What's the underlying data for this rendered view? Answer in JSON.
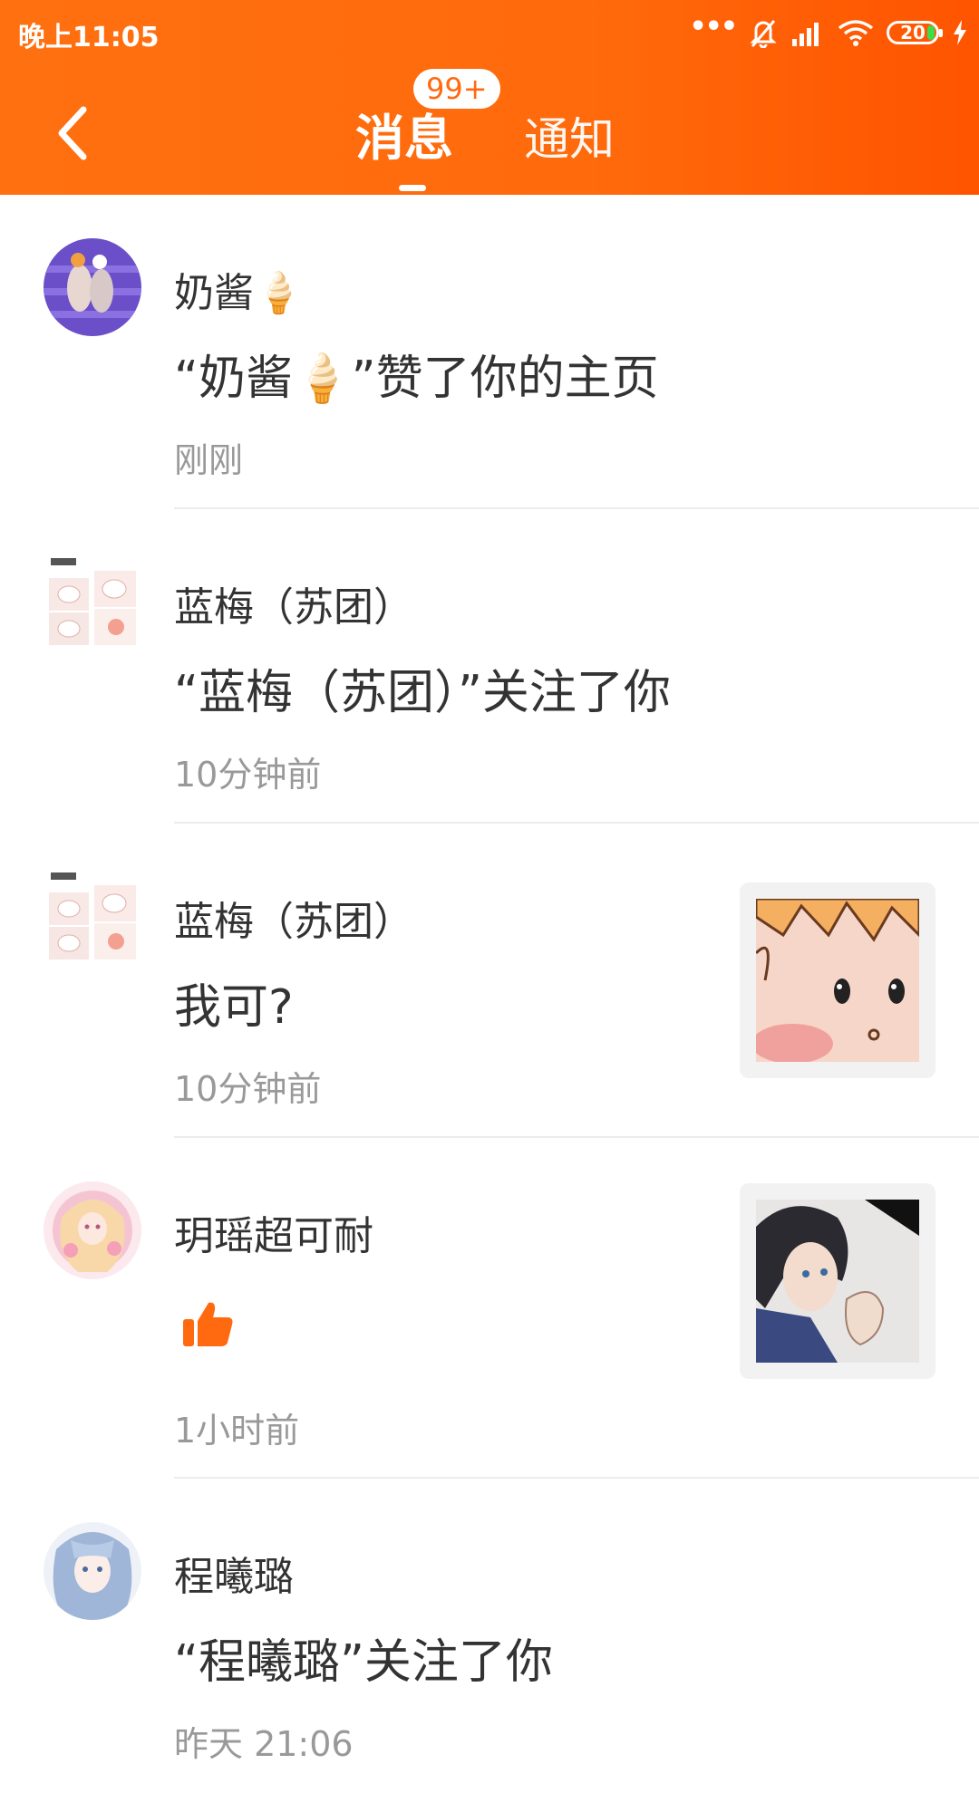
{
  "status_bar": {
    "time": "晚上11:05",
    "battery": "20",
    "icons": [
      "more-dots-icon",
      "bell-muted-icon",
      "signal-icon",
      "wifi-icon",
      "battery-icon",
      "charging-icon"
    ]
  },
  "header": {
    "back_icon": "back-arrow-icon",
    "tabs": [
      {
        "label": "消息",
        "active": true
      },
      {
        "label": "通知",
        "active": false
      }
    ],
    "badge": "99+",
    "accent": "#ff6a0c"
  },
  "messages": [
    {
      "username": "奶酱🍦",
      "content": "“奶酱🍦”赞了你的主页",
      "time": "刚刚",
      "avatar": "avatar-purple-photo"
    },
    {
      "username": "蓝梅（苏团）",
      "content": "“蓝梅（苏团）”关注了你",
      "time": "10分钟前",
      "avatar": "avatar-cute-stickers"
    },
    {
      "username": "蓝梅（苏团）",
      "content": "我可?",
      "time": "10分钟前",
      "avatar": "avatar-cute-stickers",
      "thumbnail": "cartoon-face-thumbnail"
    },
    {
      "username": "玥瑶超可耐",
      "content_icon": "thumbs-up-icon",
      "time": "1小时前",
      "avatar": "avatar-pink-anime",
      "thumbnail": "anime-boy-thumbnail"
    },
    {
      "username": "程曦璐",
      "content": "“程曦璐”关注了你",
      "time": "昨天 21:06",
      "avatar": "avatar-blue-anime"
    }
  ]
}
